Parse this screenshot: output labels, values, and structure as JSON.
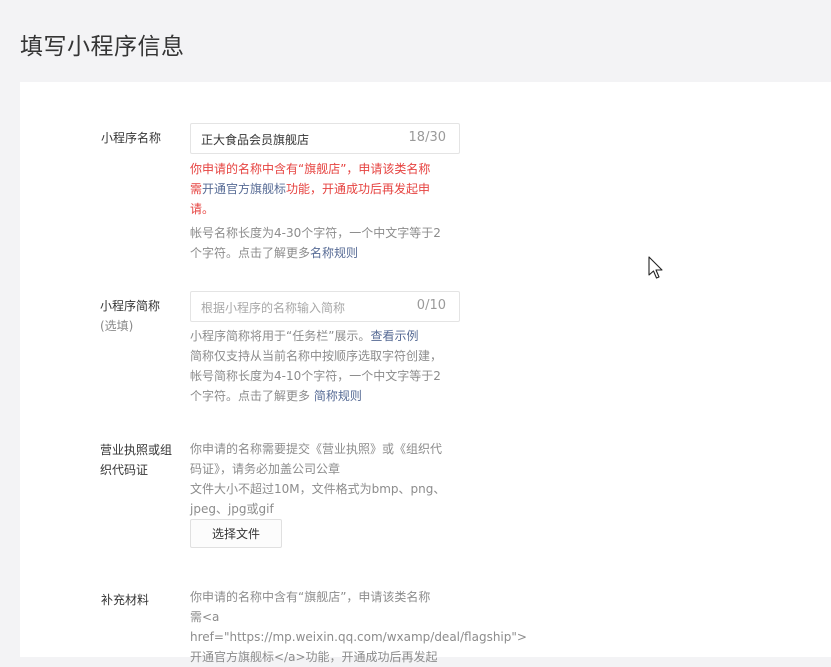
{
  "page": {
    "title": "填写小程序信息"
  },
  "name_field": {
    "label": "小程序名称",
    "value": "正大食品会员旗舰店",
    "counter": "18/30",
    "error_line1": "你申请的名称中含有“旗舰店”，申请该类名称",
    "error_line2_pre": "需",
    "error_line2_link": "开通官方旗舰标",
    "error_line2_post": "功能，开通成功后再发起申",
    "error_line3": "请。",
    "tip_line1": "帐号名称长度为4-30个字符，一个中文字等于2",
    "tip_line2_pre": "个字符。点击了解更多",
    "tip_line2_link": "名称规则"
  },
  "short_name_field": {
    "label": "小程序简称",
    "label_sub": "(选填)",
    "placeholder": "根据小程序的名称输入简称",
    "counter": "0/10",
    "tip_line1_pre": "小程序简称将用于“任务栏”展示。",
    "tip_line1_link": "查看示例",
    "tip_line2": "简称仅支持从当前名称中按顺序选取字符创建，",
    "tip_line3": "帐号简称长度为4-10个字符，一个中文字等于2",
    "tip_line4_pre": "个字符。点击了解更多 ",
    "tip_line4_link": "简称规则"
  },
  "license_field": {
    "label_line1": "营业执照或组",
    "label_line2": "织代码证",
    "tip_line1": "你申请的名称需要提交《营业执照》或《组织代",
    "tip_line2": "码证》，请务必加盖公司公章",
    "tip_line3": "文件大小不超过10M，文件格式为bmp、png、",
    "tip_line4": "jpeg、jpg或gif",
    "button_label": "选择文件"
  },
  "supplement_field": {
    "label": "补充材料",
    "tip_line1": "你申请的名称中含有“旗舰店”，申请该类名称",
    "tip_line2": "需<a",
    "tip_line3": "href=\"https://mp.weixin.qq.com/wxamp/deal/flagship\">",
    "tip_line4": "开通官方旗舰标</a>功能，开通成功后再发起"
  },
  "colors": {
    "error": "#e64340",
    "link": "#576b95",
    "tip": "#8c8c8c",
    "background": "#f3f3f5"
  },
  "icons": {
    "cursor": "mouse-pointer-icon"
  }
}
